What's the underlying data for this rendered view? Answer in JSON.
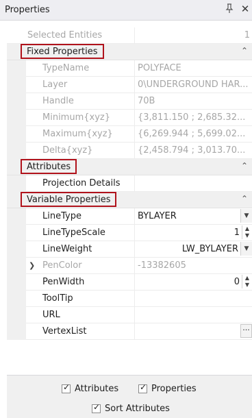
{
  "panel": {
    "title": "Properties"
  },
  "top_row": {
    "name": "Selected Entities",
    "value": "1"
  },
  "categories": {
    "fixed": "Fixed Properties",
    "attributes": "Attributes",
    "variable": "Variable Properties"
  },
  "fixed_rows": [
    {
      "name": "TypeName",
      "value": "POLYFACE"
    },
    {
      "name": "Layer",
      "value": "0\\UNDERGROUND HAR..."
    },
    {
      "name": "Handle",
      "value": "70B"
    },
    {
      "name": "Minimum{xyz}",
      "value": "{3,811.150 ; 2,685.32..."
    },
    {
      "name": "Maximum{xyz}",
      "value": "{6,269.944 ; 5,699.02..."
    },
    {
      "name": "Delta{xyz}",
      "value": "{2,458.794 ; 3,013.70..."
    }
  ],
  "attribute_rows": [
    {
      "name": "Projection Details",
      "value": ""
    }
  ],
  "variable_rows": {
    "linetype": {
      "name": "LineType",
      "value": "BYLAYER"
    },
    "linetypescale": {
      "name": "LineTypeScale",
      "value": "1"
    },
    "lineweight": {
      "name": "LineWeight",
      "value": "LW_BYLAYER"
    },
    "pencolor": {
      "name": "PenColor",
      "value": "-13382605"
    },
    "penwidth": {
      "name": "PenWidth",
      "value": "0"
    },
    "tooltip": {
      "name": "ToolTip",
      "value": ""
    },
    "url": {
      "name": "URL",
      "value": ""
    },
    "vertexlist": {
      "name": "VertexList",
      "value": ""
    }
  },
  "icons": {
    "pin": "pin-icon",
    "close": "close-icon",
    "collapse": "chevron-up-icon",
    "expand": "chevron-right-icon",
    "spin": "spinner-icon",
    "dropdown": "chevron-down-icon",
    "ellipsis": "ellipsis-icon",
    "check": "checkmark-icon"
  },
  "glyphs": {
    "ellipsis": "···"
  },
  "footer": {
    "attributes_label": "Attributes",
    "properties_label": "Properties",
    "sort_label": "Sort Attributes",
    "attributes_checked": true,
    "properties_checked": true,
    "sort_checked": true
  },
  "colors": {
    "highlight_border": "#b0121b",
    "dim_text": "#a7a7a7"
  }
}
